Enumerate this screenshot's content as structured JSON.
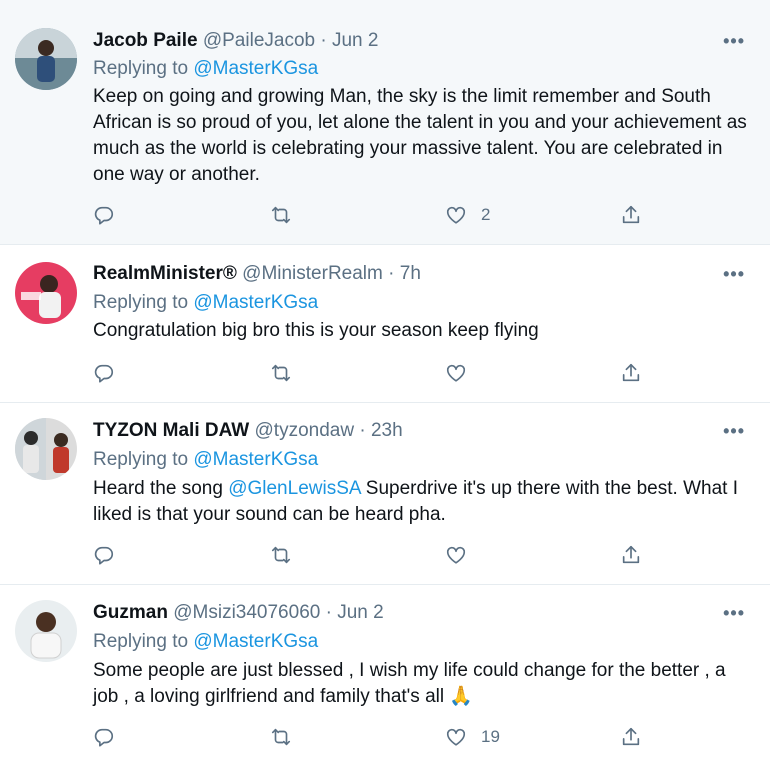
{
  "tweets": [
    {
      "name": "Jacob Paile",
      "handle": "@PaileJacob",
      "time": "Jun 2",
      "replying_label": "Replying to",
      "replying_to": "@MasterKGsa",
      "text": "Keep on going and growing Man, the sky is the limit remember and South African is so proud of you, let alone the talent in you and your achievement as much as the world is celebrating your massive talent. You are celebrated in one way or another.",
      "likes": "2",
      "highlighted": true
    },
    {
      "name": "RealmMinister®",
      "handle": "@MinisterRealm",
      "time": "7h",
      "replying_label": "Replying to",
      "replying_to": "@MasterKGsa",
      "text": "Congratulation big bro this is your season keep flying",
      "likes": ""
    },
    {
      "name": "TYZON Mali DAW",
      "handle": "@tyzondaw",
      "time": "23h",
      "replying_label": "Replying to",
      "replying_to": "@MasterKGsa",
      "text_before": "Heard the song ",
      "mention": "@GlenLewisSA",
      "text_after": " Superdrive it's up there with the best. What I liked is that your sound can be heard pha.",
      "likes": ""
    },
    {
      "name": "Guzman",
      "handle": "@Msizi34076060",
      "time": "Jun 2",
      "replying_label": "Replying to",
      "replying_to": "@MasterKGsa",
      "text": "Some people are just blessed , I wish my life could change for the better , a job , a loving girlfriend and family that's all 🙏",
      "likes": "19"
    }
  ],
  "separator": "·",
  "more_label": "•••",
  "icons": {
    "reply": "reply-icon",
    "retweet": "retweet-icon",
    "like": "heart-icon",
    "share": "share-icon",
    "more": "more-icon"
  },
  "colors": {
    "link": "#1b95e0",
    "secondary": "#5b7083",
    "highlight_bg": "#f5f8fa",
    "border": "#e6ecf0"
  }
}
